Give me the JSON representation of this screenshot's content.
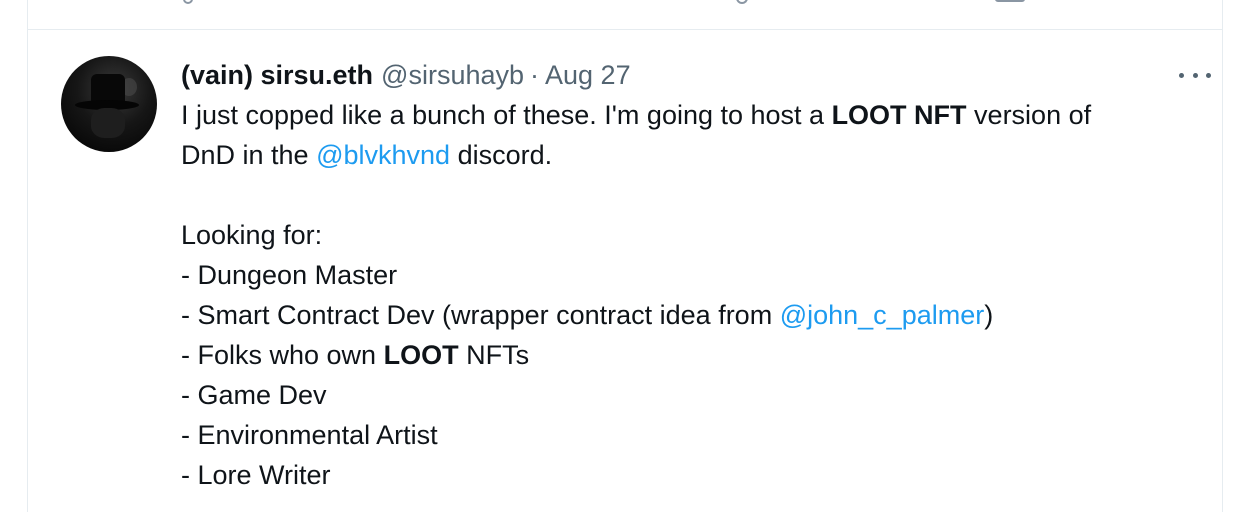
{
  "tweet": {
    "display_name": "(vain) sirsu.eth",
    "handle": "@sirsuhayb",
    "separator": "·",
    "date": "Aug 27",
    "line1_pre": "I just copped like a bunch of these. I'm going to host a ",
    "line1_bold": "LOOT NFT",
    "line1_post": " version of",
    "line2_pre": "DnD in the ",
    "line2_mention": "@blvkhvnd",
    "line2_post": " discord.",
    "looking_for": "Looking for:",
    "item1": "- Dungeon Master",
    "item2_pre": "- Smart Contract Dev (wrapper contract idea from ",
    "item2_mention": "@john_c_palmer",
    "item2_post": ")",
    "item3_pre": "- Folks who own ",
    "item3_bold": "LOOT",
    "item3_post": " NFTs",
    "item4": "- Game Dev",
    "item5": "- Environmental Artist",
    "item6": "- Lore Writer"
  },
  "icons": {
    "more": "more-horizontal-icon",
    "avatar": "profile-avatar"
  },
  "colors": {
    "mention": "#1d9bf0",
    "secondary_text": "#536471",
    "primary_text": "#0f1419",
    "border": "#e6ecf0"
  }
}
